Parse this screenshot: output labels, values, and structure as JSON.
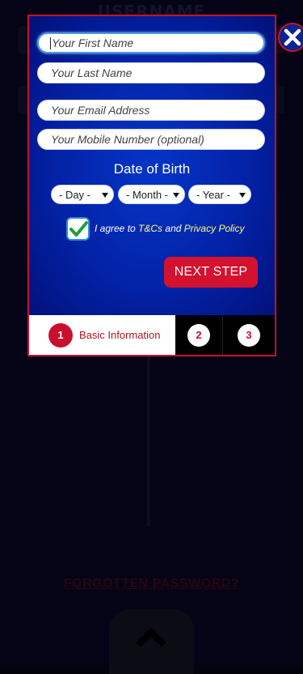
{
  "background": {
    "heading": "USERNAME",
    "link_text": "FORGOTTEN PASSWORD?"
  },
  "modal": {
    "close_icon": "close-icon",
    "fields": {
      "first_name_placeholder": "Your First Name",
      "last_name_placeholder": "Your Last Name",
      "email_placeholder": "Your Email Address",
      "mobile_placeholder": "Your Mobile Number (optional)"
    },
    "dob": {
      "title": "Date of Birth",
      "day": "- Day -",
      "month": "- Month -",
      "year": "- Year -"
    },
    "agree": {
      "checked": true,
      "prefix": "I agree to",
      "tcs": "T&Cs",
      "and": "and",
      "privacy": "Privacy Policy"
    },
    "next_button": "NEXT STEP",
    "steps": [
      {
        "number": "1",
        "label": "Basic Information",
        "active": true
      },
      {
        "number": "2",
        "label": "",
        "active": false
      },
      {
        "number": "3",
        "label": "",
        "active": false
      }
    ]
  },
  "colors": {
    "accent_red": "#c8102e",
    "modal_blue": "#0535c8",
    "link_yellow": "#ffff7a"
  }
}
